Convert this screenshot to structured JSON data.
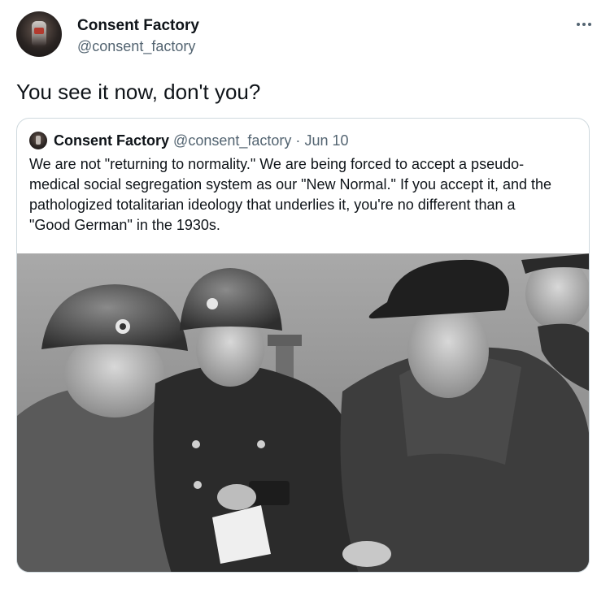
{
  "author": {
    "display_name": "Consent Factory",
    "handle": "@consent_factory"
  },
  "tweet": {
    "text": "You see it now, don't you?"
  },
  "menu": {
    "icon": "more-horizontal-icon"
  },
  "quoted_tweet": {
    "display_name": "Consent Factory",
    "handle": "@consent_factory",
    "separator": "·",
    "date": "Jun 10",
    "text_lines": [
      "We are not \"returning to normality.\" We are being forced to accept a pseudo-",
      "medical social segregation system as our \"New Normal.\" If you accept it, and the",
      "pathologized totalitarian ideology that underlies it, you're no different than a",
      "\"Good German\" in the 1930s."
    ],
    "media": {
      "kind": "black-and-white historical photograph"
    }
  },
  "colors": {
    "text": "#0f1419",
    "secondary_text": "#536471",
    "border": "#cfd9de",
    "background": "#ffffff"
  }
}
